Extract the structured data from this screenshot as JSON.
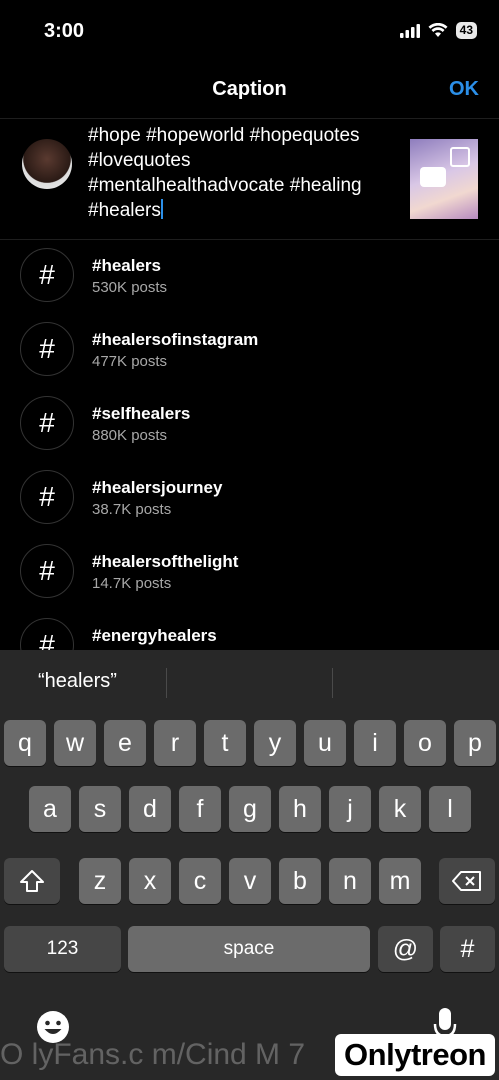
{
  "status": {
    "time": "3:00",
    "battery": "43"
  },
  "header": {
    "title": "Caption",
    "ok_label": "OK"
  },
  "caption": {
    "text": "#hope #hopeworld #hopequotes\n#lovequotes\n#mentalhealthadvocate #healing\n#healers"
  },
  "suggestions": [
    {
      "tag": "#healers",
      "count": "530K posts"
    },
    {
      "tag": "#healersofinstagram",
      "count": "477K posts"
    },
    {
      "tag": "#selfhealers",
      "count": "880K posts"
    },
    {
      "tag": "#healersjourney",
      "count": "38.7K posts"
    },
    {
      "tag": "#healersofthelight",
      "count": "14.7K posts"
    },
    {
      "tag": "#energyhealers",
      "count": ""
    }
  ],
  "keyboard": {
    "prediction": "“healers”",
    "row1": [
      "q",
      "w",
      "e",
      "r",
      "t",
      "y",
      "u",
      "i",
      "o",
      "p"
    ],
    "row2": [
      "a",
      "s",
      "d",
      "f",
      "g",
      "h",
      "j",
      "k",
      "l"
    ],
    "row3": [
      "z",
      "x",
      "c",
      "v",
      "b",
      "n",
      "m"
    ],
    "numbers_label": "123",
    "space_label": "space",
    "at_label": "@",
    "hash_label": "#"
  },
  "watermark": {
    "text": "O lyFans.c m/Cind  M   7",
    "logo": "Onlytreon"
  }
}
